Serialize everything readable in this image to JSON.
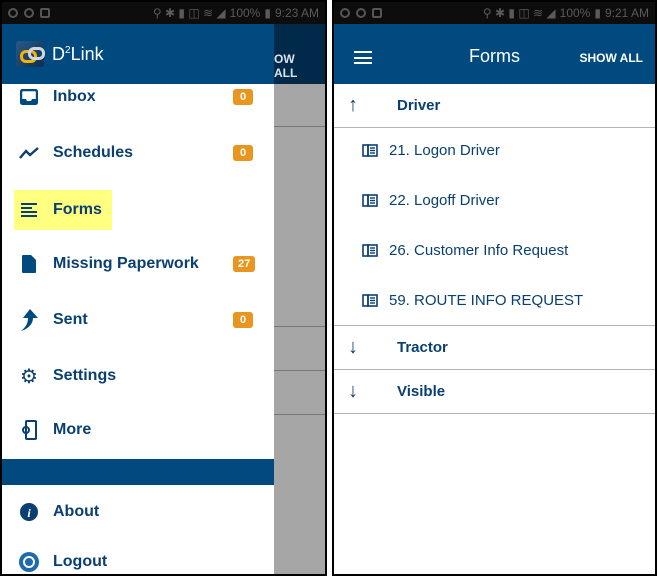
{
  "left_screen": {
    "status_bar": {
      "battery": "100%",
      "time": "9:23 AM"
    },
    "behind_action": "OW ALL",
    "drawer": {
      "app_name": "D",
      "app_name_sup": "2",
      "app_name_rest": "Link",
      "items": [
        {
          "label": "Inbox",
          "icon": "inbox-icon",
          "badge": "0"
        },
        {
          "label": "Schedules",
          "icon": "trend-icon",
          "badge": "0"
        },
        {
          "label": "Forms",
          "icon": "forms-icon",
          "highlighted": true
        },
        {
          "label": "Missing Paperwork",
          "icon": "document-icon",
          "badge": "27"
        },
        {
          "label": "Sent",
          "icon": "send-arrow-icon",
          "badge": "0"
        },
        {
          "label": "Settings",
          "icon": "gear-icon"
        },
        {
          "label": "More",
          "icon": "more-settings-icon"
        },
        {
          "label": "About",
          "icon": "info-icon"
        },
        {
          "label": "Logout",
          "icon": "logout-icon"
        }
      ]
    }
  },
  "right_screen": {
    "status_bar": {
      "battery": "100%",
      "time": "9:21 AM"
    },
    "title": "Forms",
    "show_all_label": "SHOW ALL",
    "groups": [
      {
        "label": "Driver",
        "expanded": true,
        "arrow": "↑",
        "forms": [
          "21. Logon Driver",
          "22. Logoff Driver",
          "26. Customer Info Request",
          "59. ROUTE INFO REQUEST"
        ]
      },
      {
        "label": "Tractor",
        "expanded": false,
        "arrow": "↓"
      },
      {
        "label": "Visible",
        "expanded": false,
        "arrow": "↓"
      }
    ]
  },
  "colors": {
    "primary": "#004a80",
    "badge": "#e8961f",
    "highlight": "#ffff80",
    "text": "#0a3f72"
  }
}
